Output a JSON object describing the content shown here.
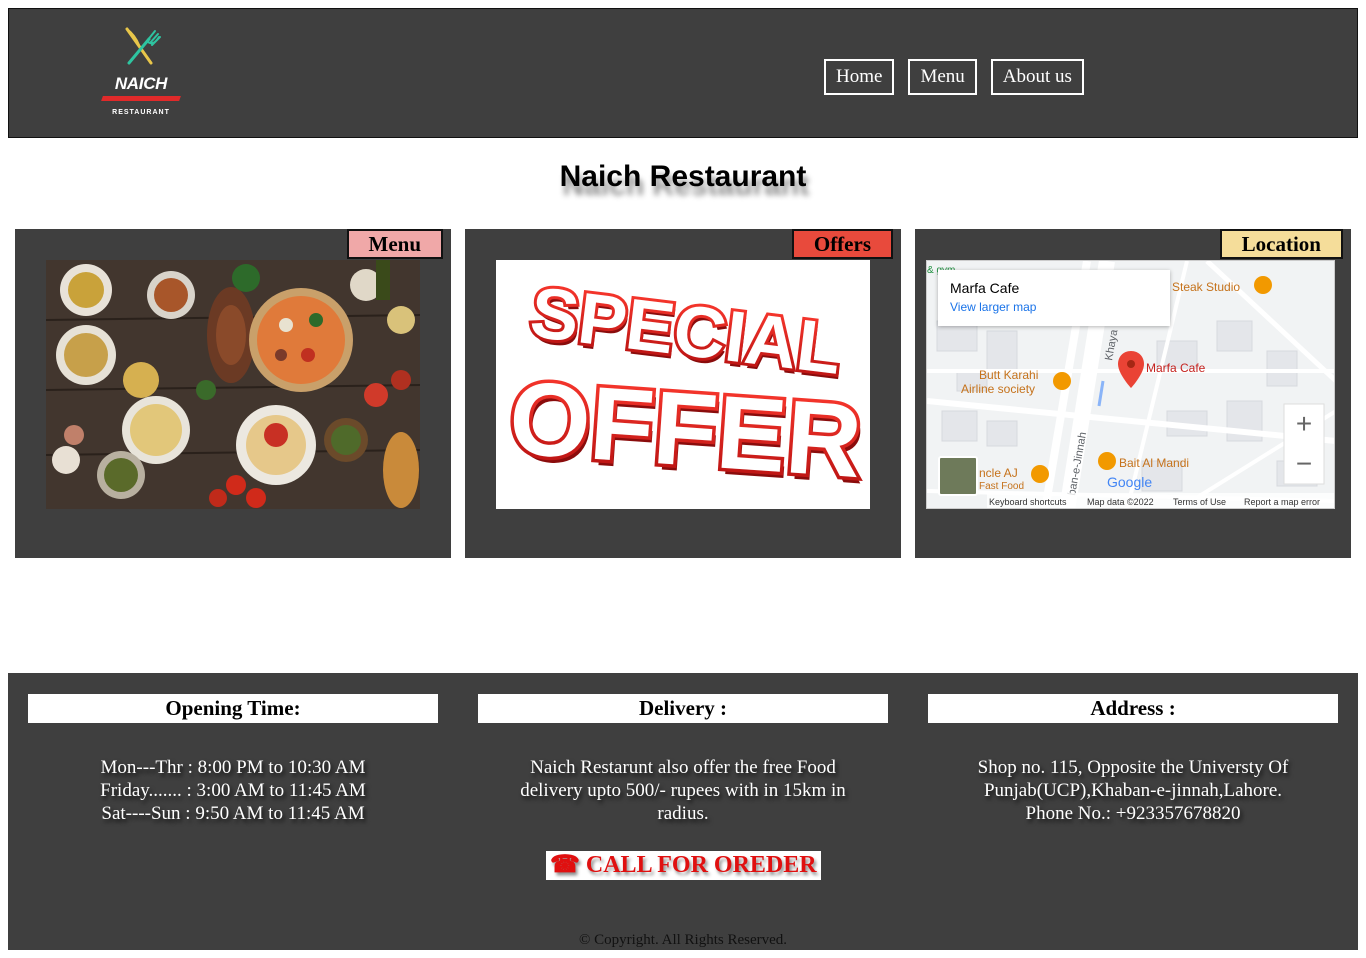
{
  "header": {
    "logo": {
      "title": "NAICH",
      "subtitle": "RESTAURANT"
    },
    "nav": [
      {
        "label": "Home"
      },
      {
        "label": "Menu"
      },
      {
        "label": "About us"
      }
    ]
  },
  "page_title": "Naich Restaurant",
  "cards": [
    {
      "tag": "Menu",
      "tag_color": "#f0a8a8"
    },
    {
      "tag": "Offers",
      "tag_color": "#e84a3c",
      "image_text_line1": "SPECIAL",
      "image_text_line2": "OFFER"
    },
    {
      "tag": "Location",
      "tag_color": "#f5dd9a"
    }
  ],
  "map": {
    "place_name": "Marfa Cafe",
    "larger_map_link": "View larger map",
    "labels": {
      "steak": "Steak Studio",
      "marker": "Marfa Cafe",
      "butt": "Butt Karahi",
      "airline": "Airline society",
      "bait": "Bait Al Mandi",
      "uncle": "ncle AJ",
      "fast": "Fast Food",
      "khaya": "Khaya",
      "jinnah": "ban-e-Jinnah",
      "gym": "& gym"
    },
    "zoom_in": "+",
    "zoom_out": "−",
    "brand": "Google",
    "footer_items": [
      "Keyboard shortcuts",
      "Map data ©2022",
      "Terms of Use",
      "Report a map error"
    ]
  },
  "footer": {
    "opening": {
      "heading": "Opening Time:",
      "lines": [
        "Mon---Thr : 8:00 PM to 10:30 AM",
        "Friday....... : 3:00 AM to 11:45 AM",
        "Sat----Sun : 9:50 AM to 11:45 AM"
      ]
    },
    "delivery": {
      "heading": "Delivery :",
      "lines": [
        "Naich Restarunt also offer the free Food",
        "delivery upto 500/- rupees with in 15km in",
        "radius."
      ]
    },
    "address": {
      "heading": "Address :",
      "lines": [
        "Shop no. 115, Opposite the Universty Of",
        "Punjab(UCP),Khaban-e-jinnah,Lahore.",
        "Phone No.: +923357678820"
      ]
    },
    "call_label": "☎ CALL FOR OREDER",
    "copyright": "© Copyright. All Rights Reserved."
  }
}
